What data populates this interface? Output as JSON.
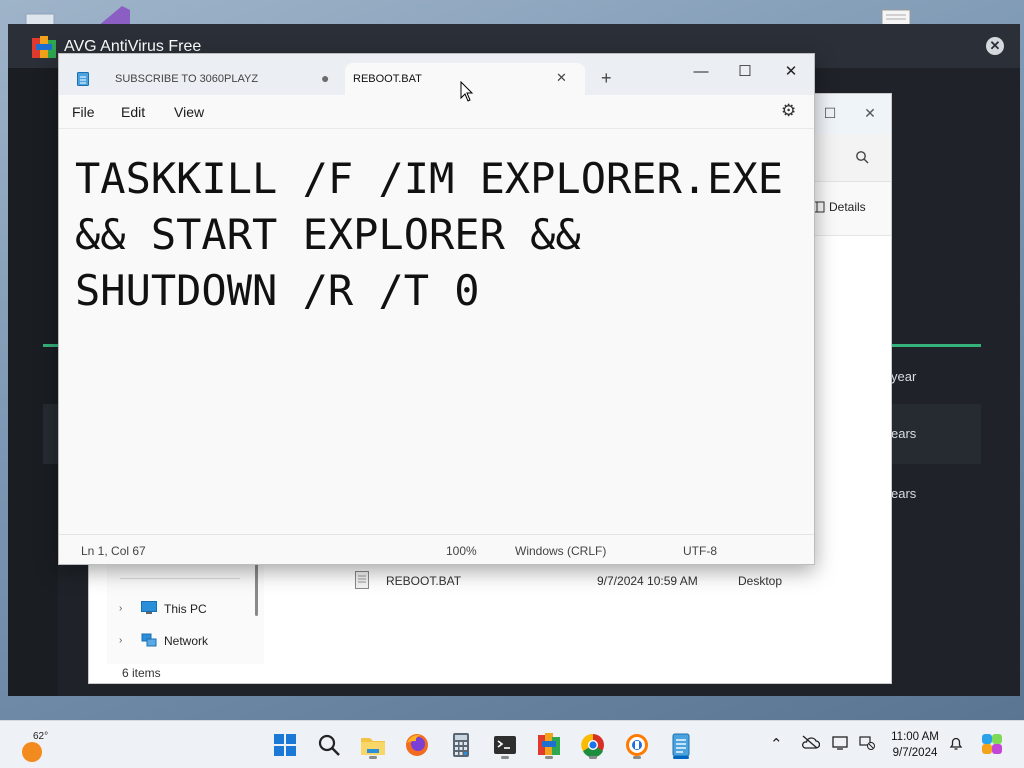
{
  "avg": {
    "title": "AVG AntiVirus Free",
    "rows": [
      "year",
      "ears",
      "ears"
    ]
  },
  "explorer": {
    "details_label": "Details",
    "nav": [
      {
        "label": "This PC"
      },
      {
        "label": "Network"
      }
    ],
    "status": "6 items",
    "file": {
      "name": "REBOOT.BAT",
      "date": "9/7/2024 10:59 AM",
      "location": "Desktop"
    }
  },
  "notepad": {
    "tabs": [
      {
        "label": "SUBSCRIBE TO 3060PLAYZ",
        "unsaved": true
      },
      {
        "label": "REBOOT.BAT",
        "active": true
      }
    ],
    "new_tab_label": "+",
    "window_buttons": {
      "minimize": "—",
      "maximize": "☐",
      "close": "✕"
    },
    "menu": {
      "file": "File",
      "edit": "Edit",
      "view": "View"
    },
    "content": "TASKKILL /F /IM EXPLORER.EXE && START EXPLORER && SHUTDOWN /R /T 0",
    "status": {
      "position": "Ln 1, Col 67",
      "zoom": "100%",
      "line_endings": "Windows (CRLF)",
      "encoding": "UTF-8"
    }
  },
  "taskbar": {
    "weather_temp": "62°",
    "apps": [
      "start",
      "search",
      "file-explorer",
      "firefox",
      "calculator",
      "terminal",
      "avg",
      "chrome",
      "another-browser",
      "notepad"
    ],
    "time": "11:00 AM",
    "date": "9/7/2024"
  },
  "colors": {
    "accent": "#0067c0",
    "avg_green": "#35b27c",
    "avg_bg": "#1f2329"
  }
}
